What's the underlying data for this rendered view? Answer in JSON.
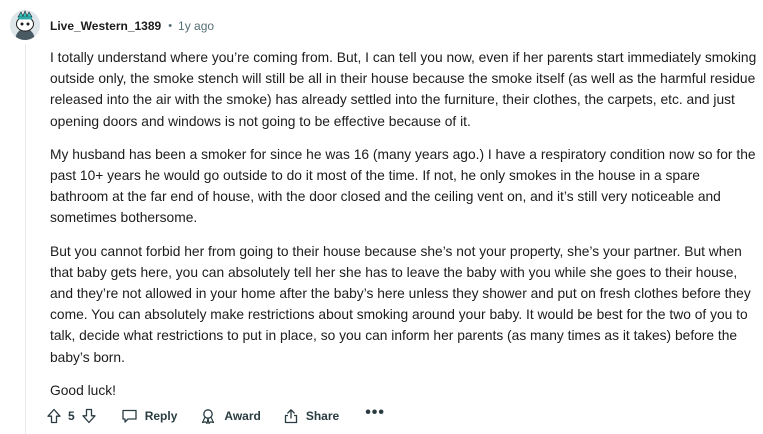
{
  "comment": {
    "author": "Live_Western_1389",
    "separator": "•",
    "time": "1y ago",
    "paragraphs": [
      "I totally understand where you’re coming from. But, I can tell you now, even if her parents start immediately smoking outside only, the smoke stench will still be all in their house because the smoke itself (as well as the harmful residue released into the air with the smoke) has already settled into the furniture, their clothes, the carpets, etc. and just opening doors and windows is not going to be effective because of it.",
      "My husband has been a smoker for since he was 16 (many years ago.) I have a respiratory condition now so for the past 10+ years he would go outside to do it most of the time. If not, he only smokes in the house in a spare bathroom at the far end of house, with the door closed and the ceiling vent on, and it’s still very noticeable and sometimes bothersome.",
      "But you cannot forbid her from going to their house because she’s not your property, she’s your partner. But when that baby gets here, you can absolutely tell her she has to leave the baby with you while she goes to their house, and they’re not allowed in your home after the baby’s here unless they shower and put on fresh clothes before they come. You can absolutely make restrictions about smoking around your baby. It would be best for the two of you to talk, decide what restrictions to put in place, so you can inform her parents (as many times as it takes) before the baby’s born.",
      "Good luck!"
    ]
  },
  "actions": {
    "score": "5",
    "reply": "Reply",
    "award": "Award",
    "share": "Share",
    "more": "•••"
  },
  "icons": {
    "upvote": "upvote-icon",
    "downvote": "downvote-icon",
    "reply": "comment-bubble-icon",
    "award": "award-icon",
    "share": "share-icon",
    "more": "overflow-menu-icon",
    "avatar": "snoo-avatar"
  },
  "colors": {
    "text": "#1c1c1c",
    "meta": "#576f76",
    "action": "#2a3c42",
    "thread_line": "#e5ebee"
  }
}
